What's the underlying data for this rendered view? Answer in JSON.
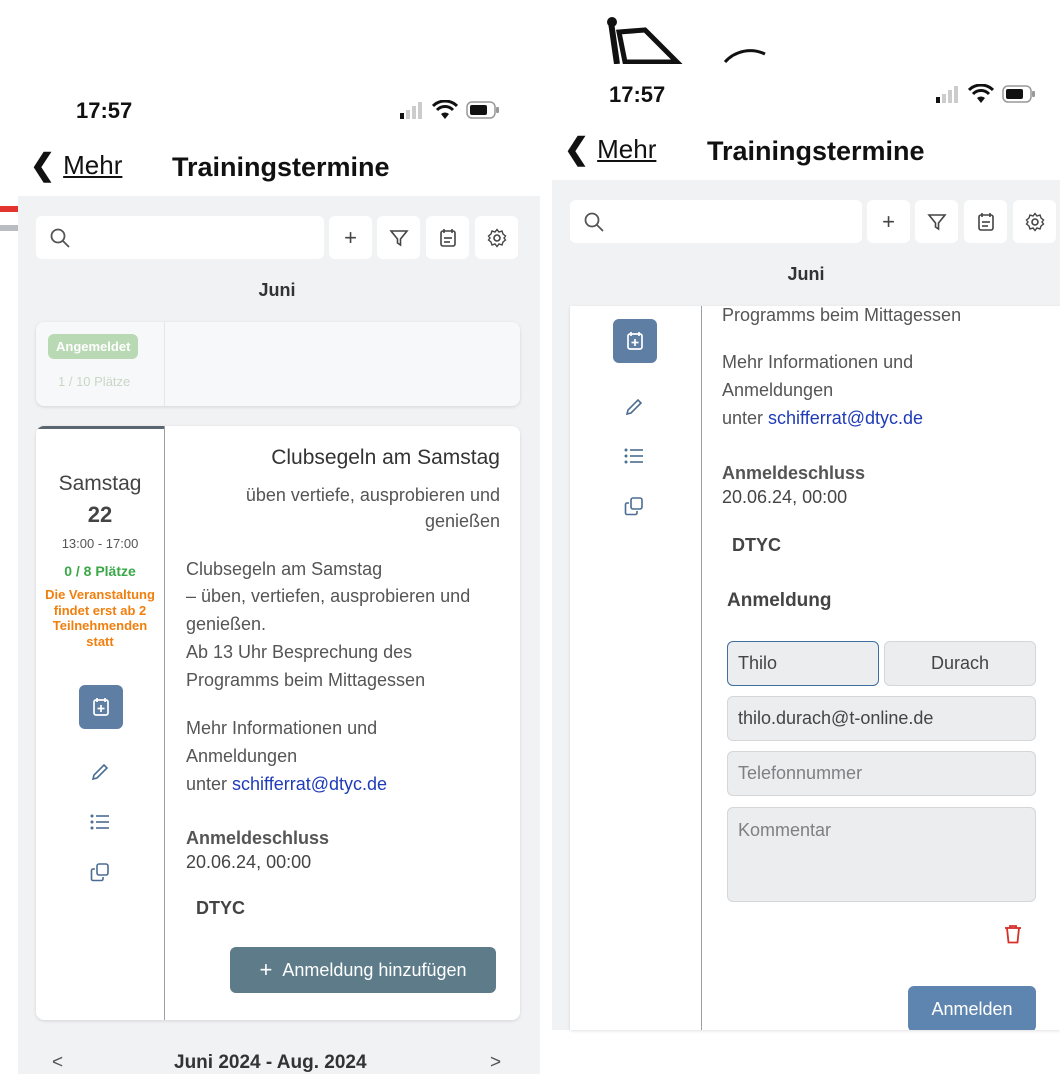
{
  "left": {
    "status": {
      "time": "17:57"
    },
    "nav": {
      "back_label": "Mehr",
      "title": "Trainingstermine"
    },
    "month": "Juni",
    "prev_card": {
      "badge": "Angemeldet",
      "places": "1 / 10 Plätze"
    },
    "event": {
      "weekday": "Samstag",
      "day": "22",
      "time": "13:00 - 17:00",
      "places": "0 / 8 Plätze",
      "notice": "Die Veranstaltung findet erst ab 2 Teilnehmenden statt",
      "title": "Clubsegeln am Samstag",
      "subtitle": "üben vertiefe, ausprobieren und genießen",
      "desc_lines": [
        "Clubsegeln am Samstag",
        "– üben, vertiefen, ausprobieren und",
        "genießen.",
        "Ab 13 Uhr  Besprechung des",
        "Programms beim Mittagessen"
      ],
      "more_lines": [
        "Mehr Informationen und",
        "Anmeldungen"
      ],
      "more_prefix": "unter ",
      "email": "schifferrat@dtyc.de",
      "deadline_label": "Anmeldeschluss",
      "deadline": "20.06.24, 00:00",
      "org": "DTYC",
      "add_button": "Anmeldung hinzufügen"
    },
    "footer": {
      "range": "Juni 2024 - Aug. 2024",
      "prev": "<",
      "next": ">"
    }
  },
  "right": {
    "status": {
      "time": "17:57"
    },
    "nav": {
      "back_label": "Mehr",
      "title": "Trainingstermine"
    },
    "month": "Juni",
    "desc_tail": "Programms beim Mittagessen",
    "more_lines": [
      "Mehr Informationen und",
      "Anmeldungen"
    ],
    "more_prefix": "unter ",
    "email": "schifferrat@dtyc.de",
    "deadline_label": "Anmeldeschluss",
    "deadline": "20.06.24, 00:00",
    "org": "DTYC",
    "form": {
      "heading": "Anmeldung",
      "first_name": "Thilo",
      "last_name": "Durach",
      "email": "thilo.durach@t-online.de",
      "phone_placeholder": "Telefonnummer",
      "comment_placeholder": "Kommentar",
      "submit": "Anmelden"
    }
  },
  "colors": {
    "accent": "#5f7ea3",
    "add_button": "#5d7b89",
    "green": "#3aa847",
    "orange": "#f07f0e",
    "link": "#1f3bb8",
    "red": "#e3342f"
  }
}
